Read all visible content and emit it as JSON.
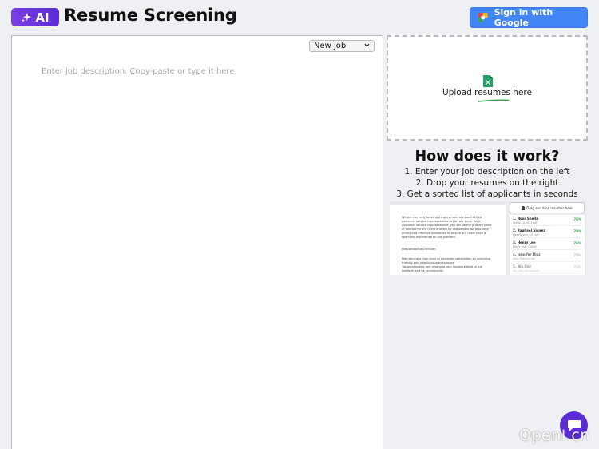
{
  "header": {
    "logo_text": "AI",
    "title": "Resume Screening",
    "signin_label": "Sign in with Google"
  },
  "editor": {
    "job_select_value": "New job",
    "placeholder": "Enter job description. Copy-paste or type it here."
  },
  "upload": {
    "label": "Upload resumes here"
  },
  "how": {
    "title": "How does it work?",
    "steps": [
      "1. Enter your job description on the left",
      "2. Drop your resumes on the right",
      "3. Get a sorted list of applicants in seconds"
    ]
  },
  "preview": {
    "drop_label": "Drag and drop resumes here",
    "doc_lines": [
      "We are currently seeking a highly motivated and skilled",
      "customer service representative to join our team. As a",
      "customer service representative, you will be the primary point",
      "of contact for our users and will be responsible for providing",
      "timely and effective assistance to ensure our users have a",
      "seamless experience on our platform.",
      "",
      "Responsibilities include:",
      "",
      "Maintaining a high level of customer satisfaction by providing",
      "friendly and helpful support to users",
      "Troubleshooting and resolving user issues related to the",
      "platform and its functionality"
    ],
    "candidates": [
      {
        "name": "1. Noor Sheila",
        "file": "Sheila CV 2023.pdf",
        "score": "76%"
      },
      {
        "name": "2. Raphael Saurez",
        "file": "RaphSaurez_CV_.pdf",
        "score": "79%"
      },
      {
        "name": "3. Henry Lee",
        "file": "Henry Lee - CV.pdf",
        "score": "76%"
      },
      {
        "name": "4. Jennifer Diaz",
        "file": "Jenni Resume.pdf",
        "score": "75%"
      },
      {
        "name": "5. Nia Day",
        "file": "Nia_Day_resume.pdf",
        "score": "73%"
      }
    ]
  },
  "watermark": "OpenI.cn",
  "colors": {
    "accent": "#5b2bd4",
    "google_blue": "#4285f4",
    "score_green": "#2aa14b"
  }
}
